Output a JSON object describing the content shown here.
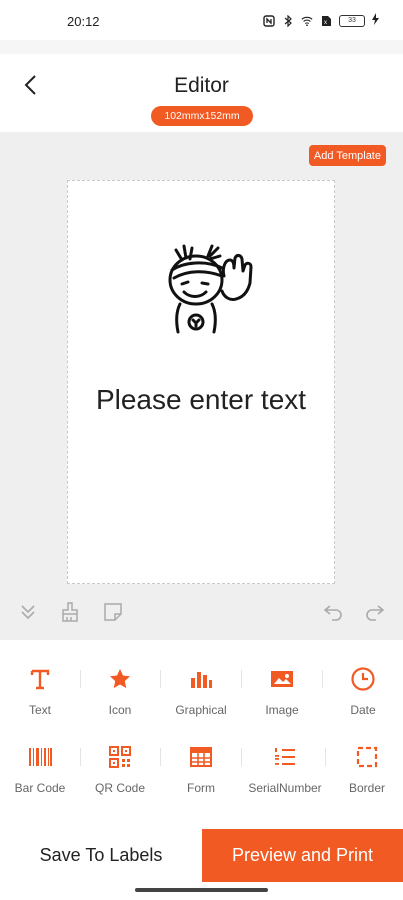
{
  "status_bar": {
    "time": "20:12",
    "battery": "33",
    "icons": [
      "nfc-icon",
      "bluetooth-icon",
      "wifi-icon",
      "sim-icon",
      "battery-icon",
      "charging-icon"
    ]
  },
  "header": {
    "title": "Editor",
    "label_size": "102mmx152mm",
    "back_icon": "chevron-left-icon"
  },
  "canvas": {
    "add_template_label": "Add Template",
    "placeholder_text": "Please enter text",
    "tools": [
      "collapse-icon",
      "brush-icon",
      "note-icon",
      "undo-icon",
      "redo-icon"
    ]
  },
  "toolbox": {
    "row1": [
      {
        "label": "Text",
        "icon": "text-icon"
      },
      {
        "label": "Icon",
        "icon": "star-icon"
      },
      {
        "label": "Graphical",
        "icon": "bar-chart-icon"
      },
      {
        "label": "Image",
        "icon": "image-icon"
      },
      {
        "label": "Date",
        "icon": "clock-icon"
      }
    ],
    "row2": [
      {
        "label": "Bar Code",
        "icon": "barcode-icon"
      },
      {
        "label": "QR Code",
        "icon": "qr-code-icon"
      },
      {
        "label": "Form",
        "icon": "table-icon"
      },
      {
        "label": "SerialNumber",
        "icon": "list-numbered-icon"
      },
      {
        "label": "Border",
        "icon": "dashed-border-icon"
      }
    ]
  },
  "footer": {
    "save_label": "Save To Labels",
    "print_label": "Preview and Print"
  },
  "colors": {
    "accent": "#f25a24",
    "canvas_bg": "#efefef",
    "tool_label": "#666666"
  }
}
